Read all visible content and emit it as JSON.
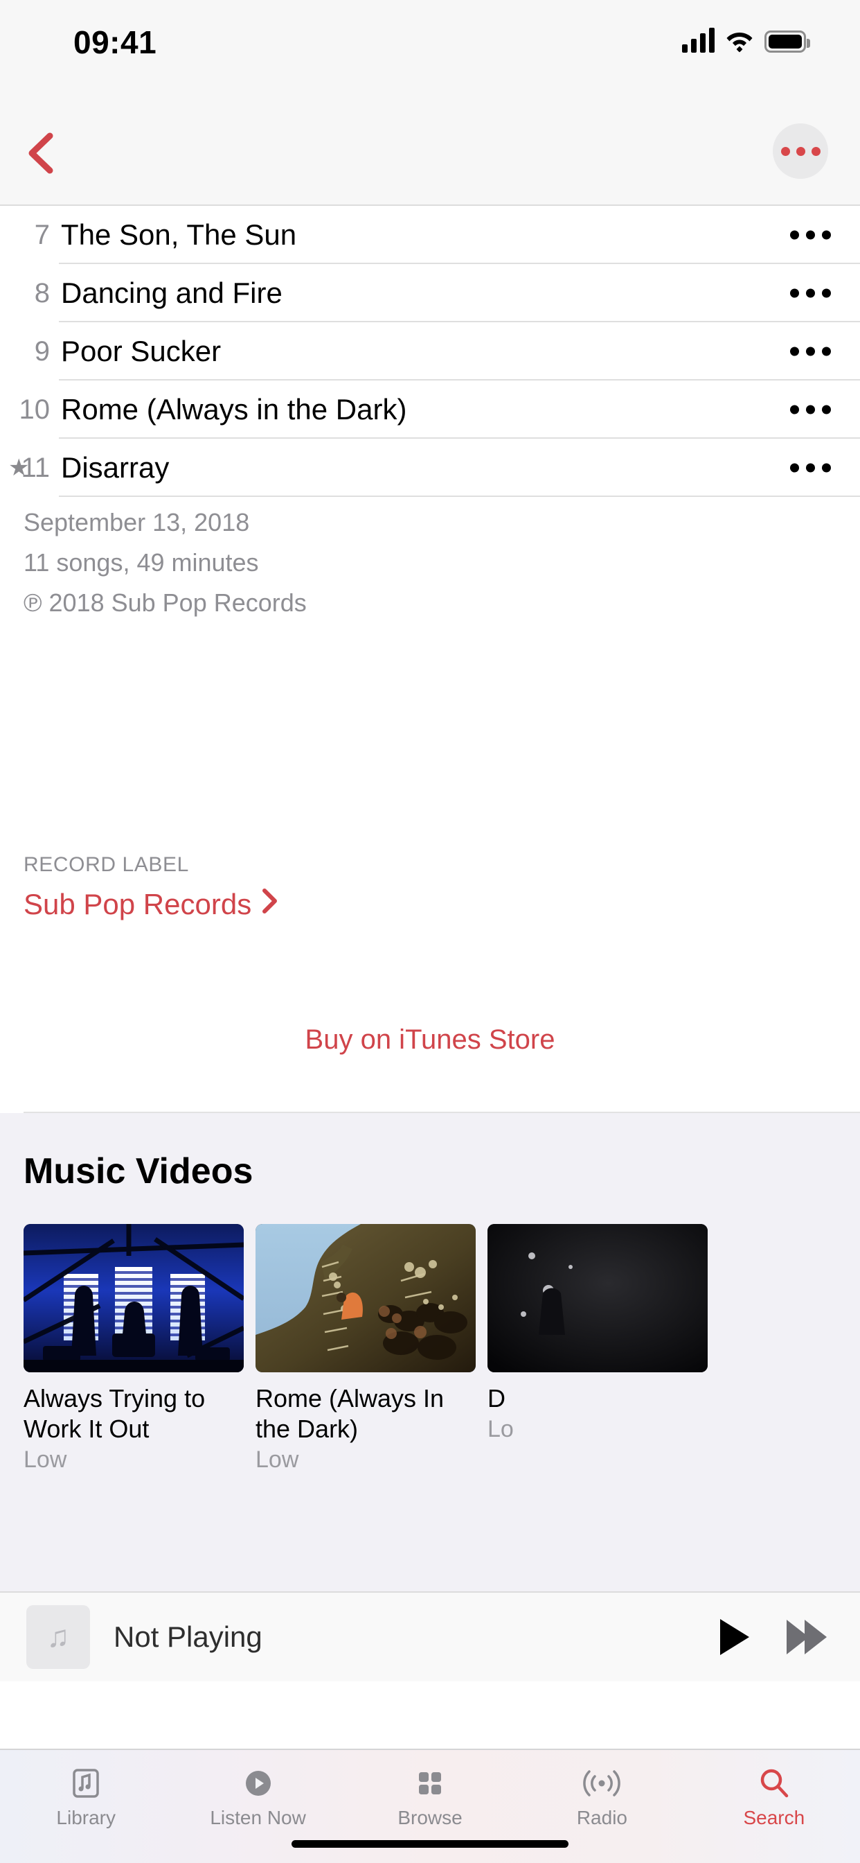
{
  "status_bar": {
    "time": "09:41",
    "cellular_icon": "signal-bars-icon",
    "wifi_icon": "wifi-icon",
    "battery_icon": "battery-full-icon"
  },
  "nav_bar": {
    "back_icon": "back-chevron-icon",
    "more_icon": "more-options-icon",
    "accent_color": "#d0444a"
  },
  "tracks": [
    {
      "number": "7",
      "title": "The Son, The Sun",
      "favorite": false,
      "menu_icon": "ellipsis-icon"
    },
    {
      "number": "8",
      "title": "Dancing and Fire",
      "favorite": false,
      "menu_icon": "ellipsis-icon"
    },
    {
      "number": "9",
      "title": "Poor Sucker",
      "favorite": false,
      "menu_icon": "ellipsis-icon"
    },
    {
      "number": "10",
      "title": "Rome (Always in the Dark)",
      "favorite": false,
      "menu_icon": "ellipsis-icon"
    },
    {
      "number": "11",
      "title": "Disarray",
      "favorite": true,
      "star_icon": "star-filled-icon",
      "menu_icon": "ellipsis-icon"
    }
  ],
  "album_info": {
    "release_date": "September 13, 2018",
    "track_summary": "11 songs, 49 minutes",
    "copyright": "℗ 2018 Sub Pop Records",
    "record_label_heading": "RECORD LABEL",
    "record_label_name": "Sub Pop Records",
    "record_label_chevron": "chevron-right-icon",
    "buy_label": "Buy on iTunes Store"
  },
  "music_videos": {
    "section_title": "Music Videos",
    "items": [
      {
        "title": "Always Trying to Work It Out",
        "artist": "Low",
        "thumb": "blue-stage-band-silhouette"
      },
      {
        "title": "Rome (Always In the Dark)",
        "artist": "Low",
        "thumb": "brown-landscape-orange-figure"
      },
      {
        "title": "D",
        "artist": "Lo",
        "thumb": "dark-night-scene"
      }
    ]
  },
  "now_playing": {
    "artwork_icon": "music-note-icon",
    "status_text": "Not Playing",
    "play_icon": "play-icon",
    "forward_icon": "fast-forward-icon"
  },
  "tab_bar": {
    "items": [
      {
        "label": "Library",
        "icon": "library-icon",
        "active": false
      },
      {
        "label": "Listen Now",
        "icon": "listen-now-icon",
        "active": false
      },
      {
        "label": "Browse",
        "icon": "browse-grid-icon",
        "active": false
      },
      {
        "label": "Radio",
        "icon": "radio-waves-icon",
        "active": false
      },
      {
        "label": "Search",
        "icon": "search-icon",
        "active": true
      }
    ],
    "active_color": "#d8474a"
  }
}
